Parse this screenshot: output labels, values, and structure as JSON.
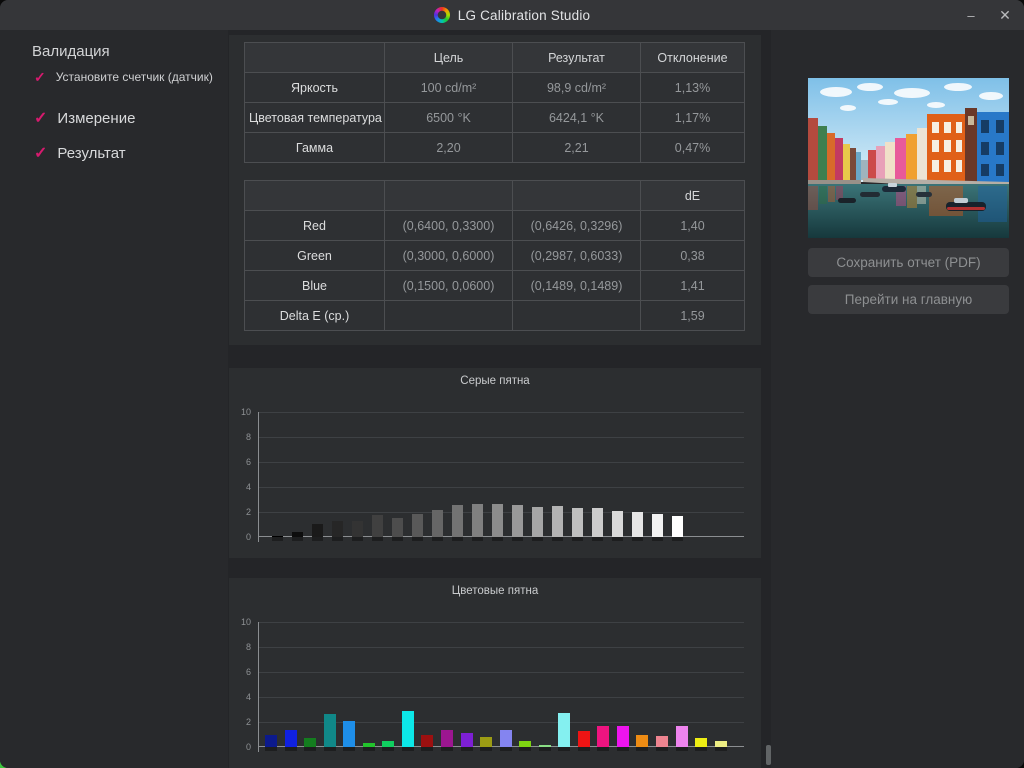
{
  "window": {
    "title": "LG Calibration Studio",
    "minimize_glyph": "–",
    "close_glyph": "✕",
    "accent_pink": "#d61a6e",
    "check_glyph": "✓"
  },
  "sidebar": {
    "title": "Валидация",
    "steps": [
      {
        "label": "Установите счетчик (датчик)",
        "checked": true,
        "small": true
      },
      {
        "label": "Измерение",
        "checked": true,
        "small": false
      },
      {
        "label": "Результат",
        "checked": true,
        "small": false
      }
    ]
  },
  "tables": {
    "main": {
      "headers": [
        "",
        "Цель",
        "Результат",
        "Отклонение"
      ],
      "rows": [
        [
          "Яркость",
          "100 cd/m²",
          "98,9 cd/m²",
          "1,13%"
        ],
        [
          "Цветовая температура",
          "6500 °K",
          "6424,1 °K",
          "1,17%"
        ],
        [
          "Гамма",
          "2,20",
          "2,21",
          "0,47%"
        ]
      ]
    },
    "colors": {
      "headers": [
        "",
        "",
        "",
        "dE"
      ],
      "rows": [
        [
          "Red",
          "(0,6400, 0,3300)",
          "(0,6426, 0,3296)",
          "1,40"
        ],
        [
          "Green",
          "(0,3000, 0,6000)",
          "(0,2987, 0,6033)",
          "0,38"
        ],
        [
          "Blue",
          "(0,1500, 0,0600)",
          "(0,1489, 0,1489)",
          "1,41"
        ],
        [
          "Delta E (ср.)",
          "",
          "",
          "1,59"
        ]
      ]
    }
  },
  "chart_data": [
    {
      "type": "bar",
      "title": "Серые пятна",
      "xlabel": "",
      "ylabel": "",
      "ylim": [
        0,
        10
      ],
      "yticks": [
        0,
        2,
        4,
        6,
        8,
        10
      ],
      "grid": true,
      "legend": "none",
      "values": [
        0.05,
        0.4,
        1.05,
        1.25,
        1.3,
        1.75,
        1.5,
        1.85,
        2.15,
        2.55,
        2.65,
        2.65,
        2.55,
        2.4,
        2.5,
        2.35,
        2.3,
        2.1,
        2.0,
        1.85,
        1.65
      ],
      "bar_colors": [
        "#000000",
        "#0d0d0d",
        "#1a1a1a",
        "#262626",
        "#333333",
        "#404040",
        "#4d4d4d",
        "#595959",
        "#666666",
        "#737373",
        "#808080",
        "#8c8c8c",
        "#999999",
        "#a6a6a6",
        "#b3b3b3",
        "#bfbfbf",
        "#cccccc",
        "#d9d9d9",
        "#e6e6e6",
        "#f2f2f2",
        "#ffffff"
      ]
    },
    {
      "type": "bar",
      "title": "Цветовые пятна",
      "xlabel": "",
      "ylabel": "",
      "ylim": [
        0,
        10
      ],
      "yticks": [
        0,
        2,
        4,
        6,
        8,
        10
      ],
      "grid": true,
      "legend": "none",
      "values": [
        1.0,
        1.4,
        0.75,
        2.65,
        2.1,
        0.3,
        0.5,
        2.9,
        1.0,
        1.35,
        1.1,
        0.8,
        1.4,
        0.45,
        0.2,
        2.75,
        1.25,
        1.7,
        1.7,
        1.0,
        0.9,
        1.7,
        0.7,
        0.5
      ],
      "bar_colors": [
        "#0c1a8c",
        "#1021e0",
        "#147d1f",
        "#108888",
        "#1e8ee8",
        "#22c32c",
        "#10cf60",
        "#0ce8e8",
        "#9c1010",
        "#9c1690",
        "#7d1fd4",
        "#9c9c14",
        "#8484f0",
        "#7ed412",
        "#8ade85",
        "#84f0f0",
        "#ee1414",
        "#ee1480",
        "#ee14ee",
        "#ee8c14",
        "#ee8490",
        "#ee84ee",
        "#eeee14",
        "#eeee84"
      ]
    }
  ],
  "actions": {
    "save_report": "Сохранить отчет (PDF)",
    "go_home": "Перейти на главную"
  }
}
